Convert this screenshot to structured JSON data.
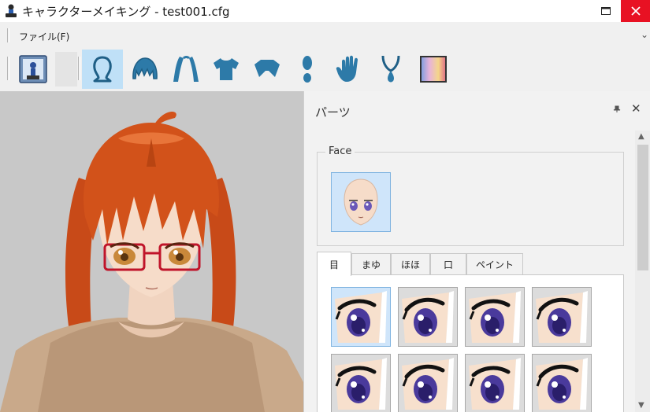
{
  "window": {
    "title": "キャラクターメイキング - test001.cfg"
  },
  "menu": {
    "file_label": "ファイル(F)",
    "overflow": "⌄"
  },
  "toolbar": {
    "items": [
      {
        "name": "character-settings-icon",
        "selected": false
      },
      {
        "name": "face-icon",
        "selected": true
      },
      {
        "name": "bangs-icon",
        "selected": false
      },
      {
        "name": "back-hair-icon",
        "selected": false
      },
      {
        "name": "shirt-icon",
        "selected": false
      },
      {
        "name": "pants-icon",
        "selected": false
      },
      {
        "name": "shoe-icon",
        "selected": false
      },
      {
        "name": "glove-icon",
        "selected": false
      },
      {
        "name": "necklace-icon",
        "selected": false
      },
      {
        "name": "color-palette-icon",
        "selected": false
      }
    ]
  },
  "panel": {
    "title": "パーツ",
    "pin_glyph": "ᵖ",
    "close_glyph": "✕",
    "face_group_label": "Face",
    "tabs": [
      "目",
      "まゆ",
      "ほほ",
      "口",
      "ペイント"
    ],
    "active_tab": 0,
    "eye_items": [
      {
        "selected": true
      },
      {
        "selected": false
      },
      {
        "selected": false
      },
      {
        "selected": false
      },
      {
        "selected": false
      },
      {
        "selected": false
      },
      {
        "selected": false
      },
      {
        "selected": false
      }
    ]
  },
  "colors": {
    "selection_bg": "#bfe0f7",
    "close_button": "#e81123",
    "hair": "#d2521a",
    "iris": "#4a3a9c"
  }
}
